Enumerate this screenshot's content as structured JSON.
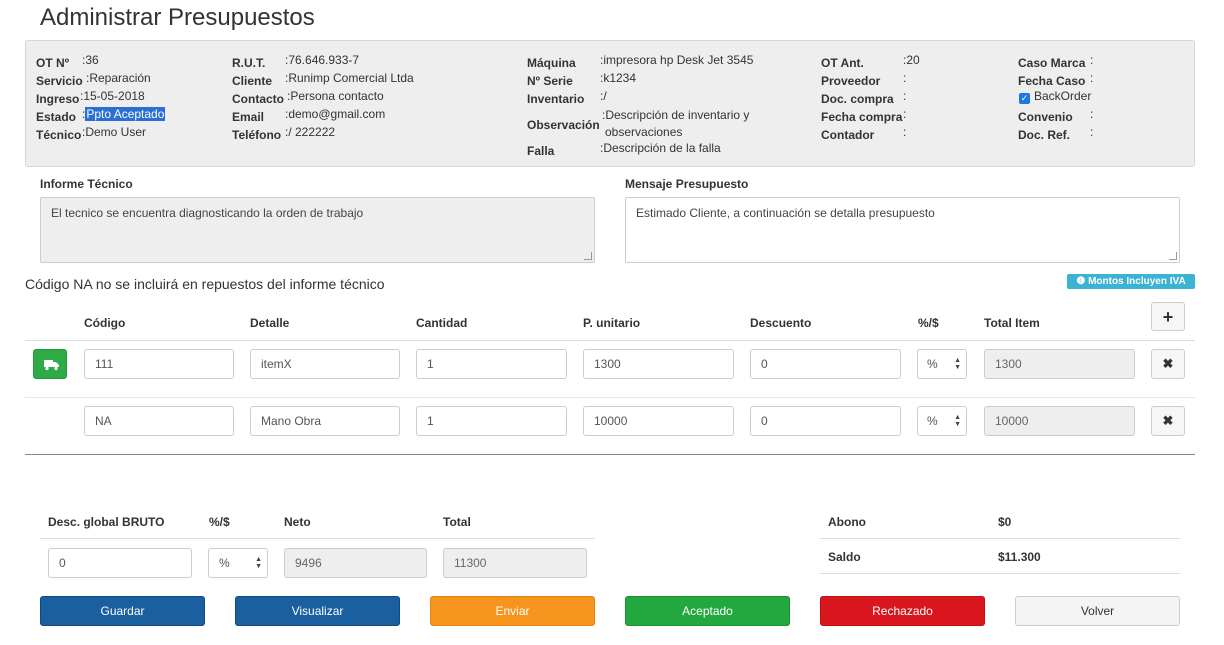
{
  "page": {
    "title": "Administrar Presupuestos"
  },
  "info": {
    "col1": [
      {
        "label": "OT Nº",
        "value": ":36"
      },
      {
        "label": "Servicio",
        "value": ":Reparación"
      },
      {
        "label": "Ingreso",
        "value": ":15-05-2018"
      },
      {
        "label": "Estado",
        "value": "Ppto Aceptado"
      },
      {
        "label": "Técnico",
        "value": ":Demo User"
      }
    ],
    "col2": [
      {
        "label": "R.U.T.",
        "value": ":76.646.933-7"
      },
      {
        "label": "Cliente",
        "value": ":Runimp Comercial Ltda"
      },
      {
        "label": "Contacto",
        "value": ":Persona contacto"
      },
      {
        "label": "Email",
        "value": ":demo@gmail.com"
      },
      {
        "label": "Teléfono",
        "value": ":/ 222222"
      }
    ],
    "col3": [
      {
        "label": "Máquina",
        "value": ":impresora hp Desk Jet 3545"
      },
      {
        "label": "Nº Serie",
        "value": ":k1234"
      },
      {
        "label": "Inventario",
        "value": ":/"
      },
      {
        "label": "Observación",
        "value_line1": ":Descripción de inventario y",
        "value_line2": "observaciones"
      },
      {
        "label": "Falla",
        "value": ":Descripción de la falla"
      }
    ],
    "col4": [
      {
        "label": "OT Ant.",
        "value": ":20"
      },
      {
        "label": "Proveedor",
        "value": ":"
      },
      {
        "label": "Doc. compra",
        "value": ":"
      },
      {
        "label": "Fecha compra",
        "value": ":"
      },
      {
        "label": "Contador",
        "value": ":"
      }
    ],
    "col5": [
      {
        "label": "Caso Marca",
        "value": ":"
      },
      {
        "label": "Fecha Caso",
        "value": ":"
      },
      {
        "label": "BackOrder",
        "value": ""
      },
      {
        "label": "Convenio",
        "value": ":"
      },
      {
        "label": "Doc. Ref.",
        "value": ":"
      }
    ],
    "estado_prefix": ":"
  },
  "informe": {
    "label": "Informe Técnico",
    "text": "El tecnico se encuentra diagnosticando la orden de trabajo"
  },
  "mensaje": {
    "label": "Mensaje Presupuesto",
    "text": "Estimado Cliente, a continuación se detalla presupuesto"
  },
  "note": "Código NA no se incluirá en repuestos del informe técnico",
  "iva_badge": "Montos Incluyen IVA",
  "table": {
    "headers": [
      "Código",
      "Detalle",
      "Cantidad",
      "P. unitario",
      "Descuento",
      "%/$",
      "Total Item"
    ],
    "rows": [
      {
        "codigo": "111",
        "detalle": "itemX",
        "cantidad": "1",
        "unitario": "1300",
        "descuento": "0",
        "tipo": "%",
        "total": "1300"
      },
      {
        "codigo": "NA",
        "detalle": "Mano Obra",
        "cantidad": "1",
        "unitario": "10000",
        "descuento": "0",
        "tipo": "%",
        "total": "10000"
      }
    ],
    "add_label": "+",
    "remove_label": "✖"
  },
  "totals": {
    "headers": [
      "Desc. global BRUTO",
      "%/$",
      "Neto",
      "Total"
    ],
    "desc_global": "0",
    "tipo": "%",
    "neto": "9496",
    "total": "11300"
  },
  "summary": {
    "abono_label": "Abono",
    "abono_value": "$0",
    "saldo_label": "Saldo",
    "saldo_value": "$11.300"
  },
  "buttons": {
    "guardar": "Guardar",
    "visualizar": "Visualizar",
    "enviar": "Enviar",
    "aceptado": "Aceptado",
    "rechazado": "Rechazado",
    "volver": "Volver"
  },
  "colors": {
    "primary": "#1a5fa0",
    "warning": "#f7941d",
    "success": "#23a840",
    "danger": "#d9161e",
    "info": "#3bb3d2"
  }
}
